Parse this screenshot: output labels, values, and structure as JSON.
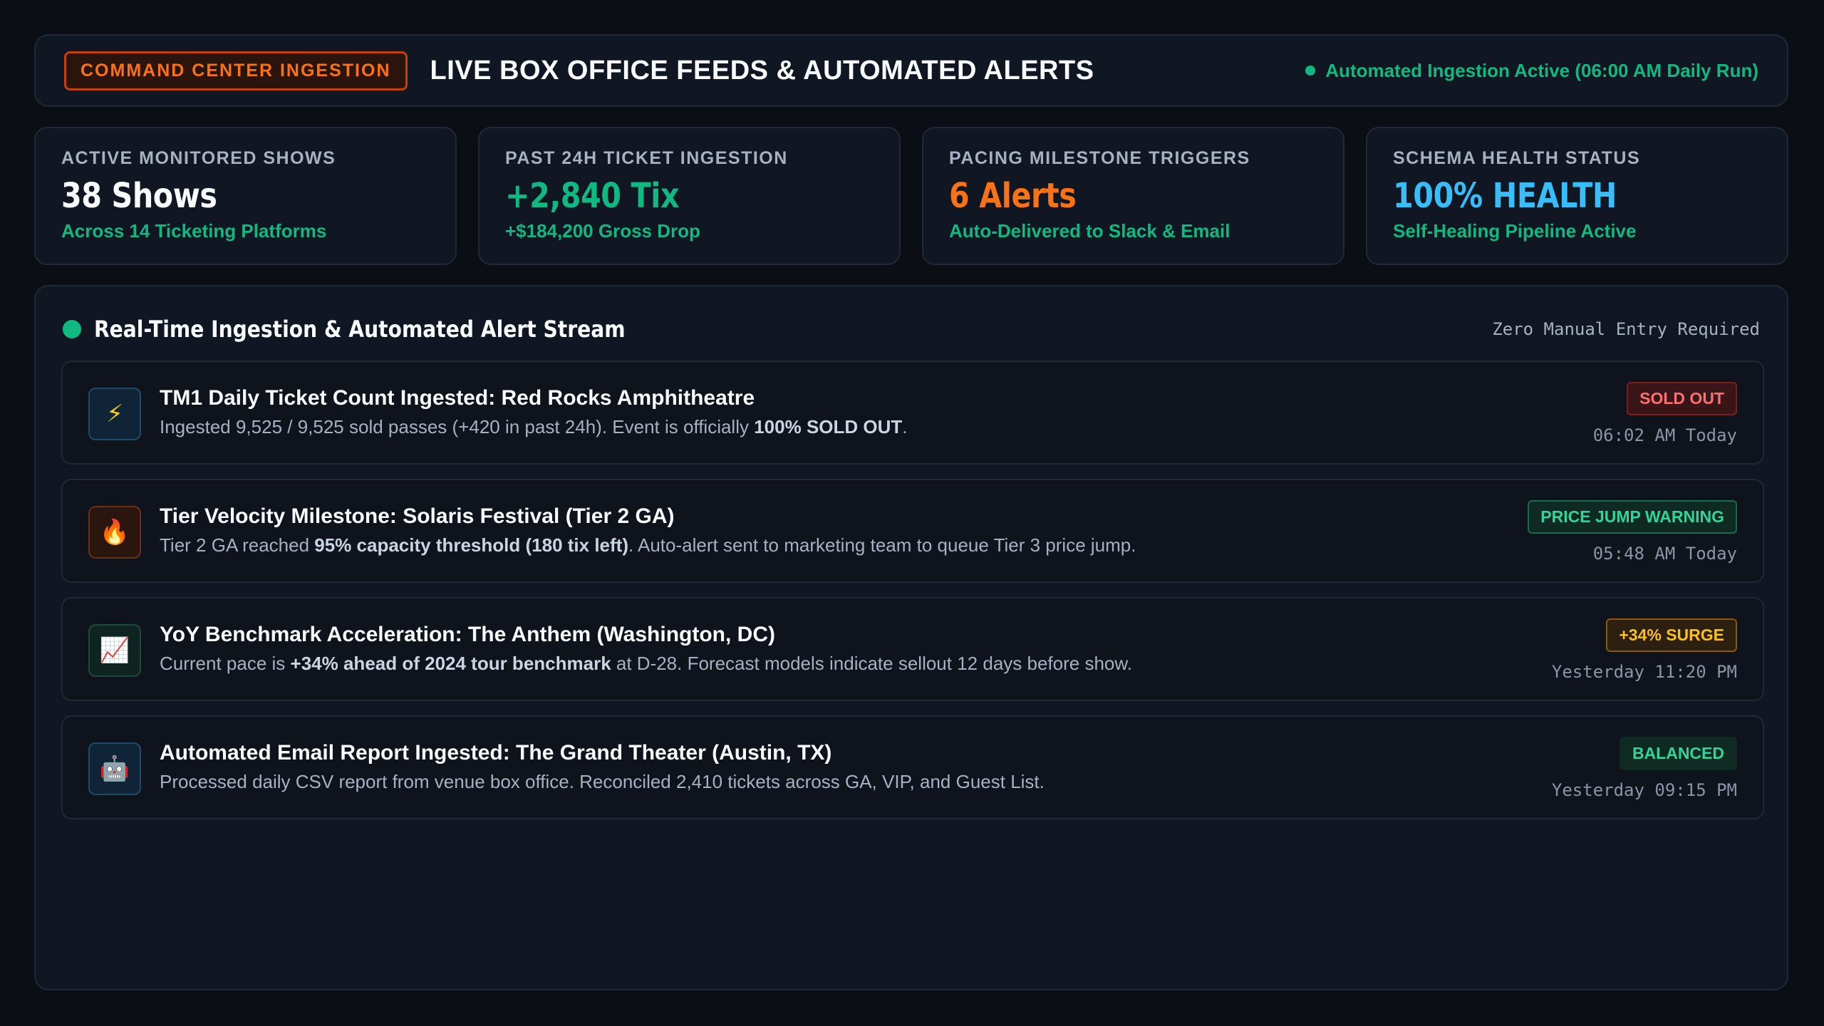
{
  "header": {
    "badge": "COMMAND CENTER INGESTION",
    "title": "LIVE BOX OFFICE FEEDS & AUTOMATED ALERTS",
    "status": "Automated Ingestion Active (06:00 AM Daily Run)"
  },
  "kpis": [
    {
      "label": "ACTIVE MONITORED SHOWS",
      "value": "38 Shows",
      "sub": "Across 14 Ticketing Platforms",
      "color": "#f8fafc"
    },
    {
      "label": "PAST 24H TICKET INGESTION",
      "value": "+2,840 Tix",
      "sub": "+$184,200 Gross Drop",
      "color": "#10b981"
    },
    {
      "label": "PACING MILESTONE TRIGGERS",
      "value": "6 Alerts",
      "sub": "Auto-Delivered to Slack & Email",
      "color": "#f97316"
    },
    {
      "label": "SCHEMA HEALTH STATUS",
      "value": "100% HEALTH",
      "sub": "Self-Healing Pipeline Active",
      "color": "#38bdf8"
    }
  ],
  "stream": {
    "title": "Real-Time Ingestion & Automated Alert Stream",
    "note": "Zero Manual Entry Required",
    "items": [
      {
        "icon": "lightning-icon",
        "glyph": "⚡",
        "title": "TM1 Daily Ticket Count Ingested: Red Rocks Amphitheatre",
        "desc_pre": "Ingested 9,525 / 9,525 sold passes (+420 in past 24h). Event is officially ",
        "desc_bold": "100% SOLD OUT",
        "desc_post": ".",
        "badge": "SOLD OUT",
        "time": "06:02 AM Today"
      },
      {
        "icon": "fire-icon",
        "glyph": "🔥",
        "title": "Tier Velocity Milestone: Solaris Festival (Tier 2 GA)",
        "desc_pre": "Tier 2 GA reached ",
        "desc_bold": "95% capacity threshold (180 tix left)",
        "desc_post": ". Auto-alert sent to marketing team to queue Tier 3 price jump.",
        "badge": "PRICE JUMP WARNING",
        "time": "05:48 AM Today"
      },
      {
        "icon": "chart-increasing-icon",
        "glyph": "📈",
        "title": "YoY Benchmark Acceleration: The Anthem (Washington, DC)",
        "desc_pre": "Current pace is ",
        "desc_bold": "+34% ahead of 2024 tour benchmark",
        "desc_post": " at D-28. Forecast models indicate sellout 12 days before show.",
        "badge": "+34% SURGE",
        "time": "Yesterday 11:20 PM"
      },
      {
        "icon": "robot-icon",
        "glyph": "🤖",
        "title": "Automated Email Report Ingested: The Grand Theater (Austin, TX)",
        "desc_pre": "Processed daily CSV report from venue box office. Reconciled 2,410 tickets across GA, VIP, and Guest List.",
        "desc_bold": "",
        "desc_post": "",
        "badge": "BALANCED",
        "time": "Yesterday 09:15 PM"
      }
    ]
  }
}
